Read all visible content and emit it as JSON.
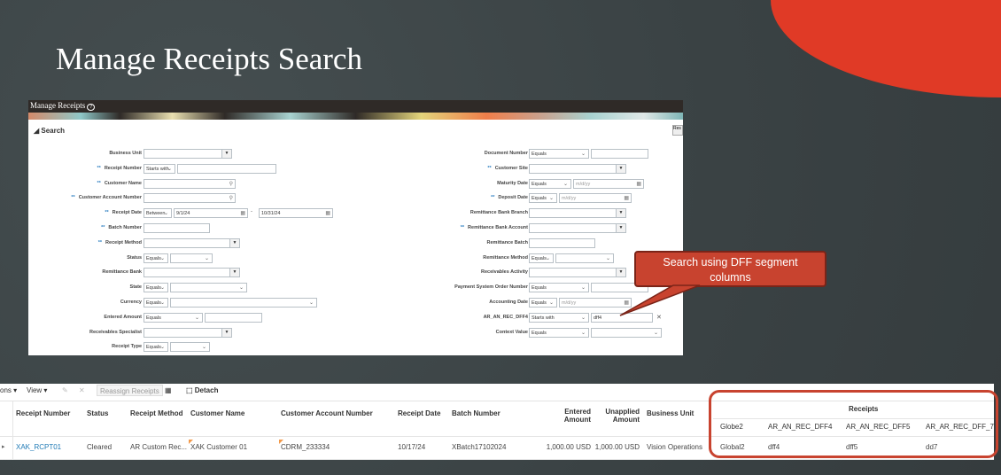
{
  "slide": {
    "title": "Manage Receipts Search"
  },
  "panel": {
    "title": "Manage Receipts",
    "help_icon": "?",
    "search_label": "Search",
    "reset_label": "Res"
  },
  "left_rows": [
    {
      "label": "Business Unit",
      "req": false,
      "controls": [
        {
          "t": "lov"
        }
      ]
    },
    {
      "label": "Receipt Number",
      "req": true,
      "controls": [
        {
          "t": "op",
          "v": "Starts with"
        },
        {
          "t": "in"
        }
      ]
    },
    {
      "label": "Customer Name",
      "req": true,
      "controls": [
        {
          "t": "search"
        }
      ]
    },
    {
      "label": "Customer Account Number",
      "req": true,
      "controls": [
        {
          "t": "search"
        }
      ]
    },
    {
      "label": "Receipt Date",
      "req": true,
      "controls": [
        {
          "t": "op",
          "v": "Between"
        },
        {
          "t": "date",
          "v": "9/1/24"
        },
        {
          "t": "dash",
          "v": "-"
        },
        {
          "t": "date",
          "v": "10/31/24"
        }
      ]
    },
    {
      "label": "Batch Number",
      "req": true,
      "controls": [
        {
          "t": "in"
        }
      ]
    },
    {
      "label": "Receipt Method",
      "req": true,
      "controls": [
        {
          "t": "lov"
        }
      ]
    },
    {
      "label": "Status",
      "req": false,
      "controls": [
        {
          "t": "op",
          "v": "Equals"
        },
        {
          "t": "sel"
        }
      ]
    },
    {
      "label": "Remittance Bank",
      "req": false,
      "controls": [
        {
          "t": "lov"
        }
      ]
    },
    {
      "label": "State",
      "req": false,
      "controls": [
        {
          "t": "op",
          "v": "Equals"
        },
        {
          "t": "sel"
        }
      ]
    },
    {
      "label": "Currency",
      "req": false,
      "controls": [
        {
          "t": "op",
          "v": "Equals"
        },
        {
          "t": "sel"
        }
      ]
    },
    {
      "label": "Entered Amount",
      "req": false,
      "controls": [
        {
          "t": "op",
          "v": "Equals"
        },
        {
          "t": "in"
        }
      ]
    },
    {
      "label": "Receivables Specialist",
      "req": false,
      "controls": [
        {
          "t": "lov"
        }
      ]
    },
    {
      "label": "Receipt Type",
      "req": false,
      "controls": [
        {
          "t": "op",
          "v": "Equals"
        },
        {
          "t": "sel"
        }
      ]
    }
  ],
  "right_rows": [
    {
      "label": "Document Number",
      "req": false,
      "controls": [
        {
          "t": "op",
          "v": "Equals"
        },
        {
          "t": "in"
        }
      ]
    },
    {
      "label": "Customer Site",
      "req": true,
      "controls": [
        {
          "t": "lov"
        }
      ]
    },
    {
      "label": "Maturity Date",
      "req": false,
      "controls": [
        {
          "t": "op",
          "v": "Equals"
        },
        {
          "t": "date",
          "p": "m/d/yy"
        }
      ]
    },
    {
      "label": "Deposit Date",
      "req": true,
      "controls": [
        {
          "t": "op",
          "v": "Equals"
        },
        {
          "t": "date",
          "p": "m/d/yy"
        }
      ]
    },
    {
      "label": "Remittance Bank Branch",
      "req": false,
      "controls": [
        {
          "t": "lov"
        }
      ]
    },
    {
      "label": "Remittance Bank Account",
      "req": true,
      "controls": [
        {
          "t": "lov"
        }
      ]
    },
    {
      "label": "Remittance Batch",
      "req": false,
      "controls": [
        {
          "t": "in"
        }
      ]
    },
    {
      "label": "Remittance Method",
      "req": false,
      "controls": [
        {
          "t": "op",
          "v": "Equals"
        },
        {
          "t": "sel"
        }
      ]
    },
    {
      "label": "Receivables Activity",
      "req": false,
      "controls": [
        {
          "t": "lov"
        }
      ]
    },
    {
      "label": "Payment System Order Number",
      "req": false,
      "controls": [
        {
          "t": "op",
          "v": "Equals"
        },
        {
          "t": "in"
        }
      ]
    },
    {
      "label": "Accounting Date",
      "req": false,
      "controls": [
        {
          "t": "op",
          "v": "Equals"
        },
        {
          "t": "date",
          "p": "m/d/yy"
        }
      ]
    },
    {
      "label": "AR_AN_REC_DFF4",
      "req": false,
      "controls": [
        {
          "t": "op",
          "v": "Starts with"
        },
        {
          "t": "in",
          "v": "dff4"
        },
        {
          "t": "clear",
          "v": "✕"
        }
      ]
    },
    {
      "label": "Context Value",
      "req": false,
      "controls": [
        {
          "t": "op",
          "v": "Equals"
        },
        {
          "t": "sel"
        }
      ]
    }
  ],
  "required_marker": "**",
  "callout": {
    "text": "Search using DFF segment columns",
    "color": "#c8432f"
  },
  "toolbar": {
    "actions": "ons ▾",
    "view": "View ▾",
    "edit_icon": "✎",
    "delete_icon": "✕",
    "reassign": "Reassign Receipts",
    "detach": "Detach"
  },
  "table": {
    "group_header": "Receipts",
    "headers": [
      "Receipt Number",
      "Status",
      "Receipt Method",
      "Customer Name",
      "Customer Account Number",
      "Receipt Date",
      "Batch Number",
      "Entered Amount",
      "Unapplied Amount",
      "Business Unit",
      "Globe2",
      "AR_AN_REC_DFF4",
      "AR_AN_REC_DFF5",
      "AR_AR_REC_DFF_7"
    ],
    "rows": [
      [
        "XAK_RCPT01",
        "Cleared",
        "AR Custom Rec...",
        "XAK Customer 01",
        "CDRM_233334",
        "10/17/24",
        "XBatch17102024",
        "1,000.00 USD",
        "1,000.00 USD",
        "Vision Operations",
        "Global2",
        "dff4",
        "dff5",
        "dd7"
      ]
    ]
  }
}
